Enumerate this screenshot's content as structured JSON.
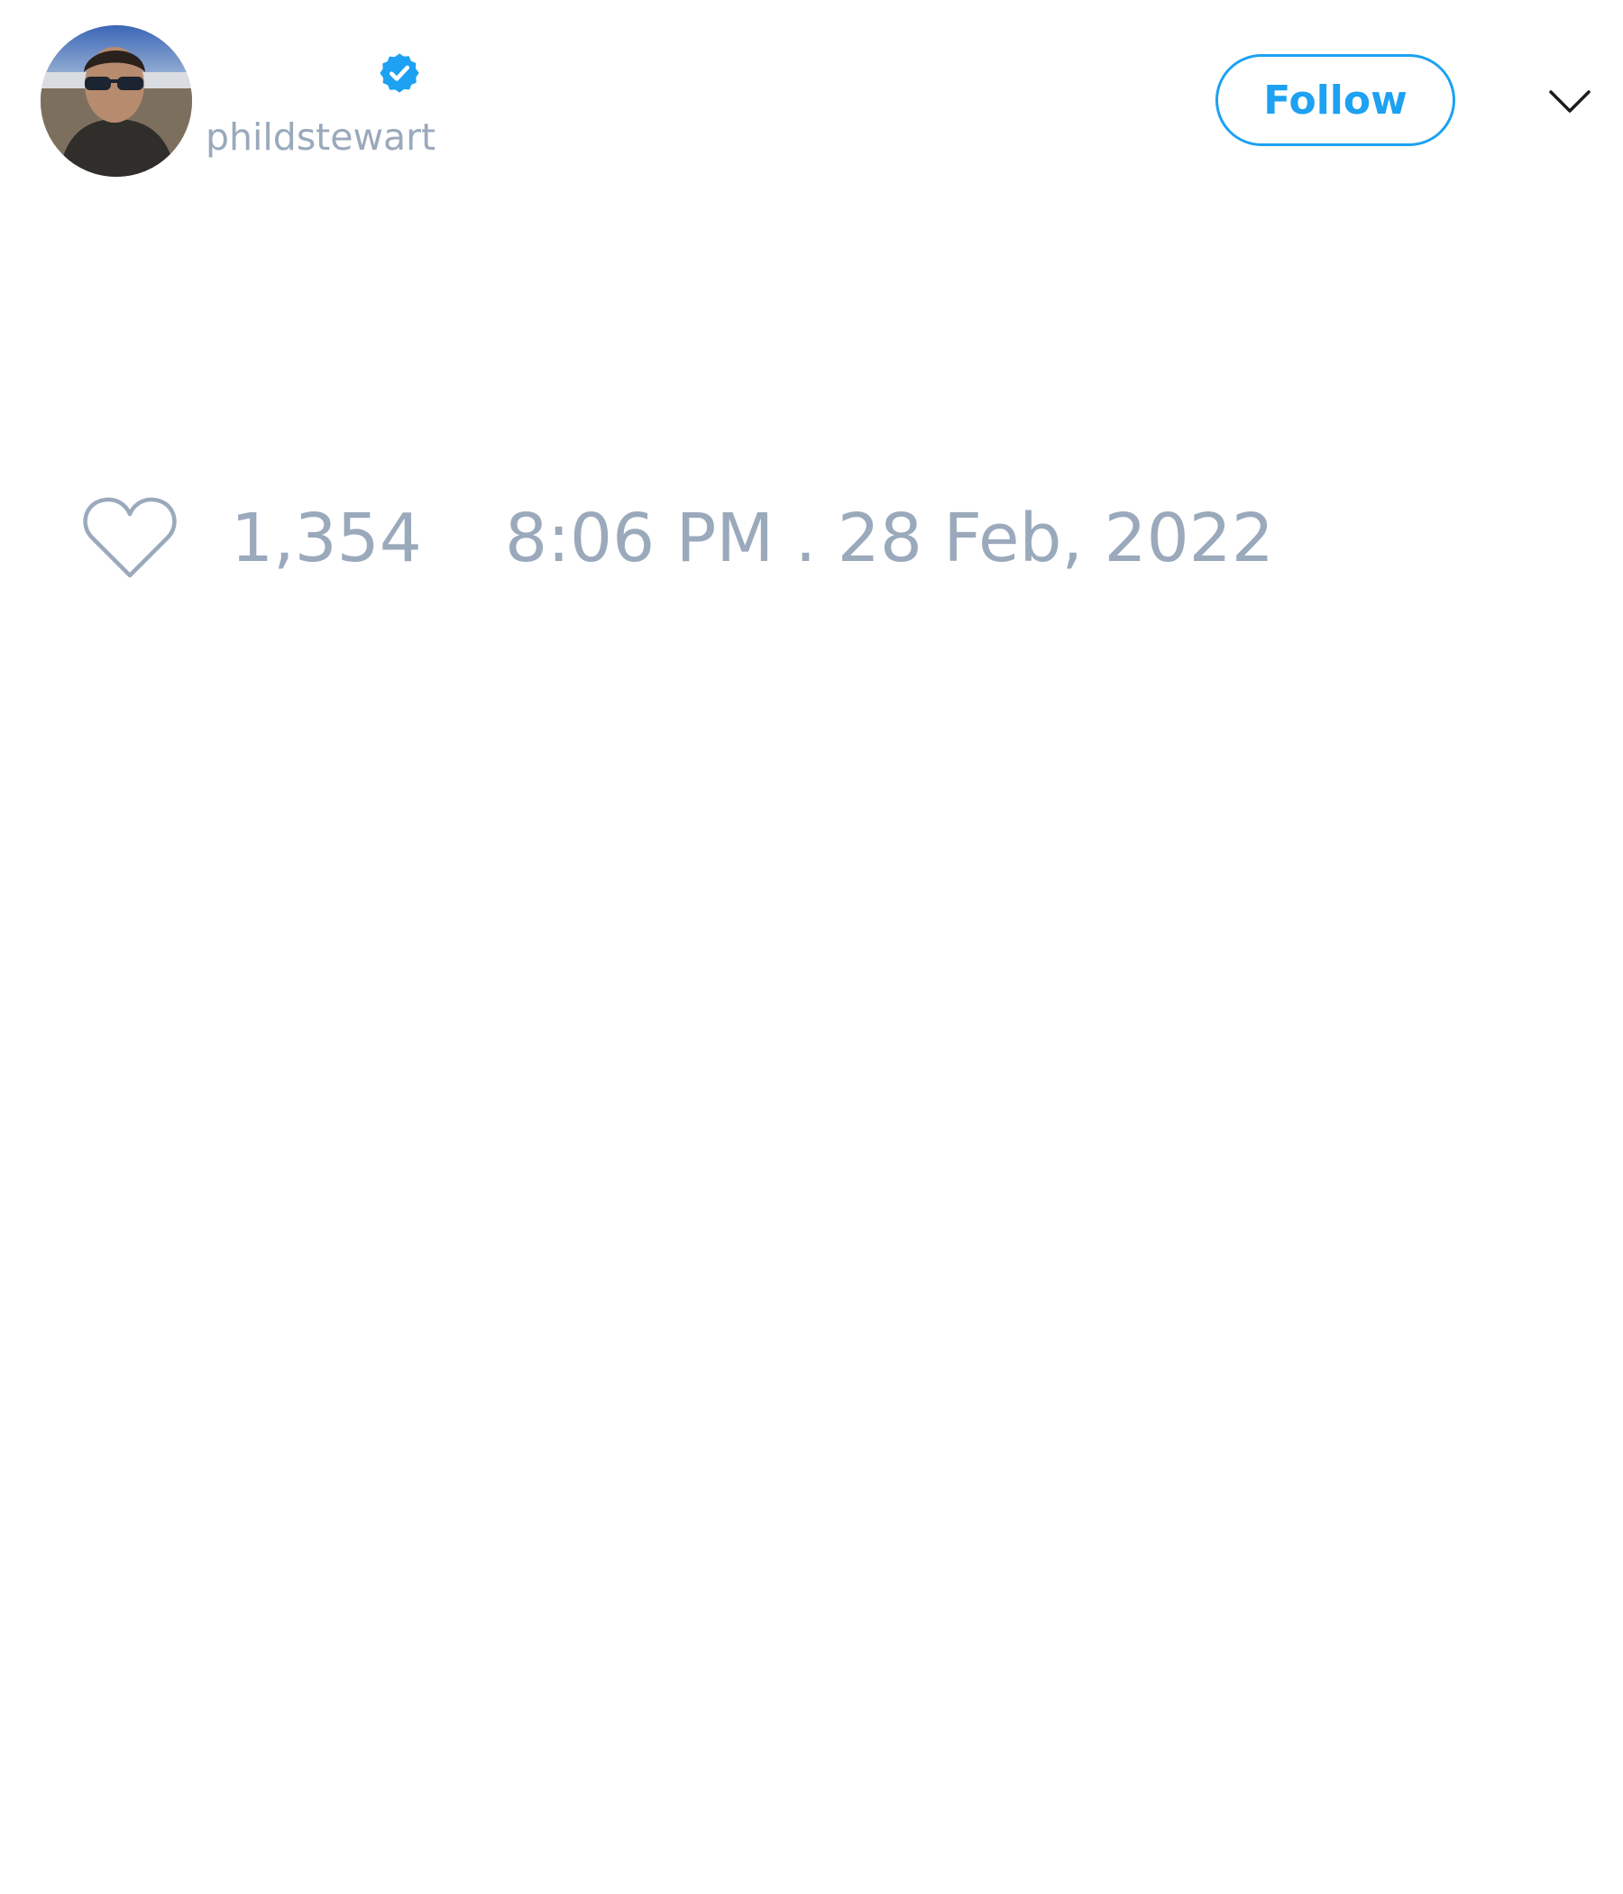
{
  "tweet": {
    "author": {
      "handle": "phildstewart",
      "verified": true,
      "avatar_icon": "user-avatar-photo"
    },
    "follow_label": "Follow",
    "menu_icon": "chevron-down-icon",
    "likes": {
      "icon": "heart-icon",
      "count": "1,354"
    },
    "timestamp": "8:06 PM . 28 Feb, 2022"
  },
  "colors": {
    "accent": "#1da1f2",
    "muted_text": "#9aa9bb",
    "background": "#ffffff"
  }
}
